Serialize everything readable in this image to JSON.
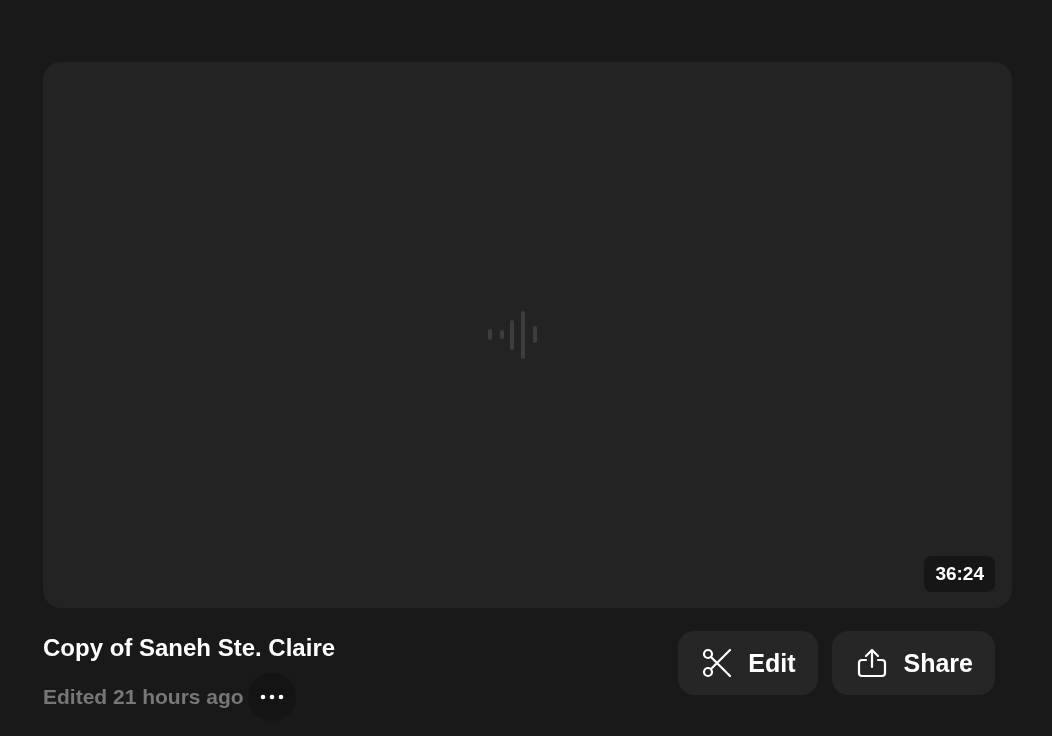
{
  "video": {
    "duration": "36:24"
  },
  "title": "Copy of Saneh Ste. Claire",
  "subtitle": "Edited 21 hours ago",
  "actions": [
    {
      "label": "Edit",
      "kind": "edit"
    },
    {
      "label": "Share",
      "kind": "share"
    }
  ]
}
